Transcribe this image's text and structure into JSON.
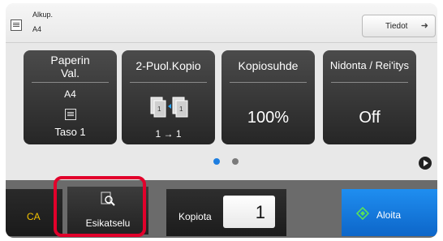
{
  "original": {
    "label": "Alkup.",
    "size": "A4",
    "icon": "original-doc-icon"
  },
  "details_button": {
    "label": "Tiedot",
    "icon": "arrow-right-icon"
  },
  "tiles": {
    "paper": {
      "title_line1": "Paperin",
      "title_line2": "Val.",
      "size": "A4",
      "tray": "Taso 1",
      "icon": "paper-tray-icon"
    },
    "duplex": {
      "title": "2-Puol.Kopio",
      "mode": "1 → 1",
      "icon": "duplex-copy-icon"
    },
    "ratio": {
      "title": "Kopiosuhde",
      "value": "100%"
    },
    "staple": {
      "title": "Nidonta / Rei'itys",
      "value": "Off"
    }
  },
  "pagination": {
    "pages": 2,
    "current": 1,
    "active_color": "#1e7ee0",
    "inactive_color": "#7a7a7a"
  },
  "bottom": {
    "ca_label": "CA",
    "preview_label": "Esikatselu",
    "copies_label": "Kopiota",
    "copies_value": "1",
    "start_label": "Aloita"
  },
  "colors": {
    "ca_text": "#f3c200",
    "start_button": "#1479e0",
    "highlight": "#e2002b"
  }
}
